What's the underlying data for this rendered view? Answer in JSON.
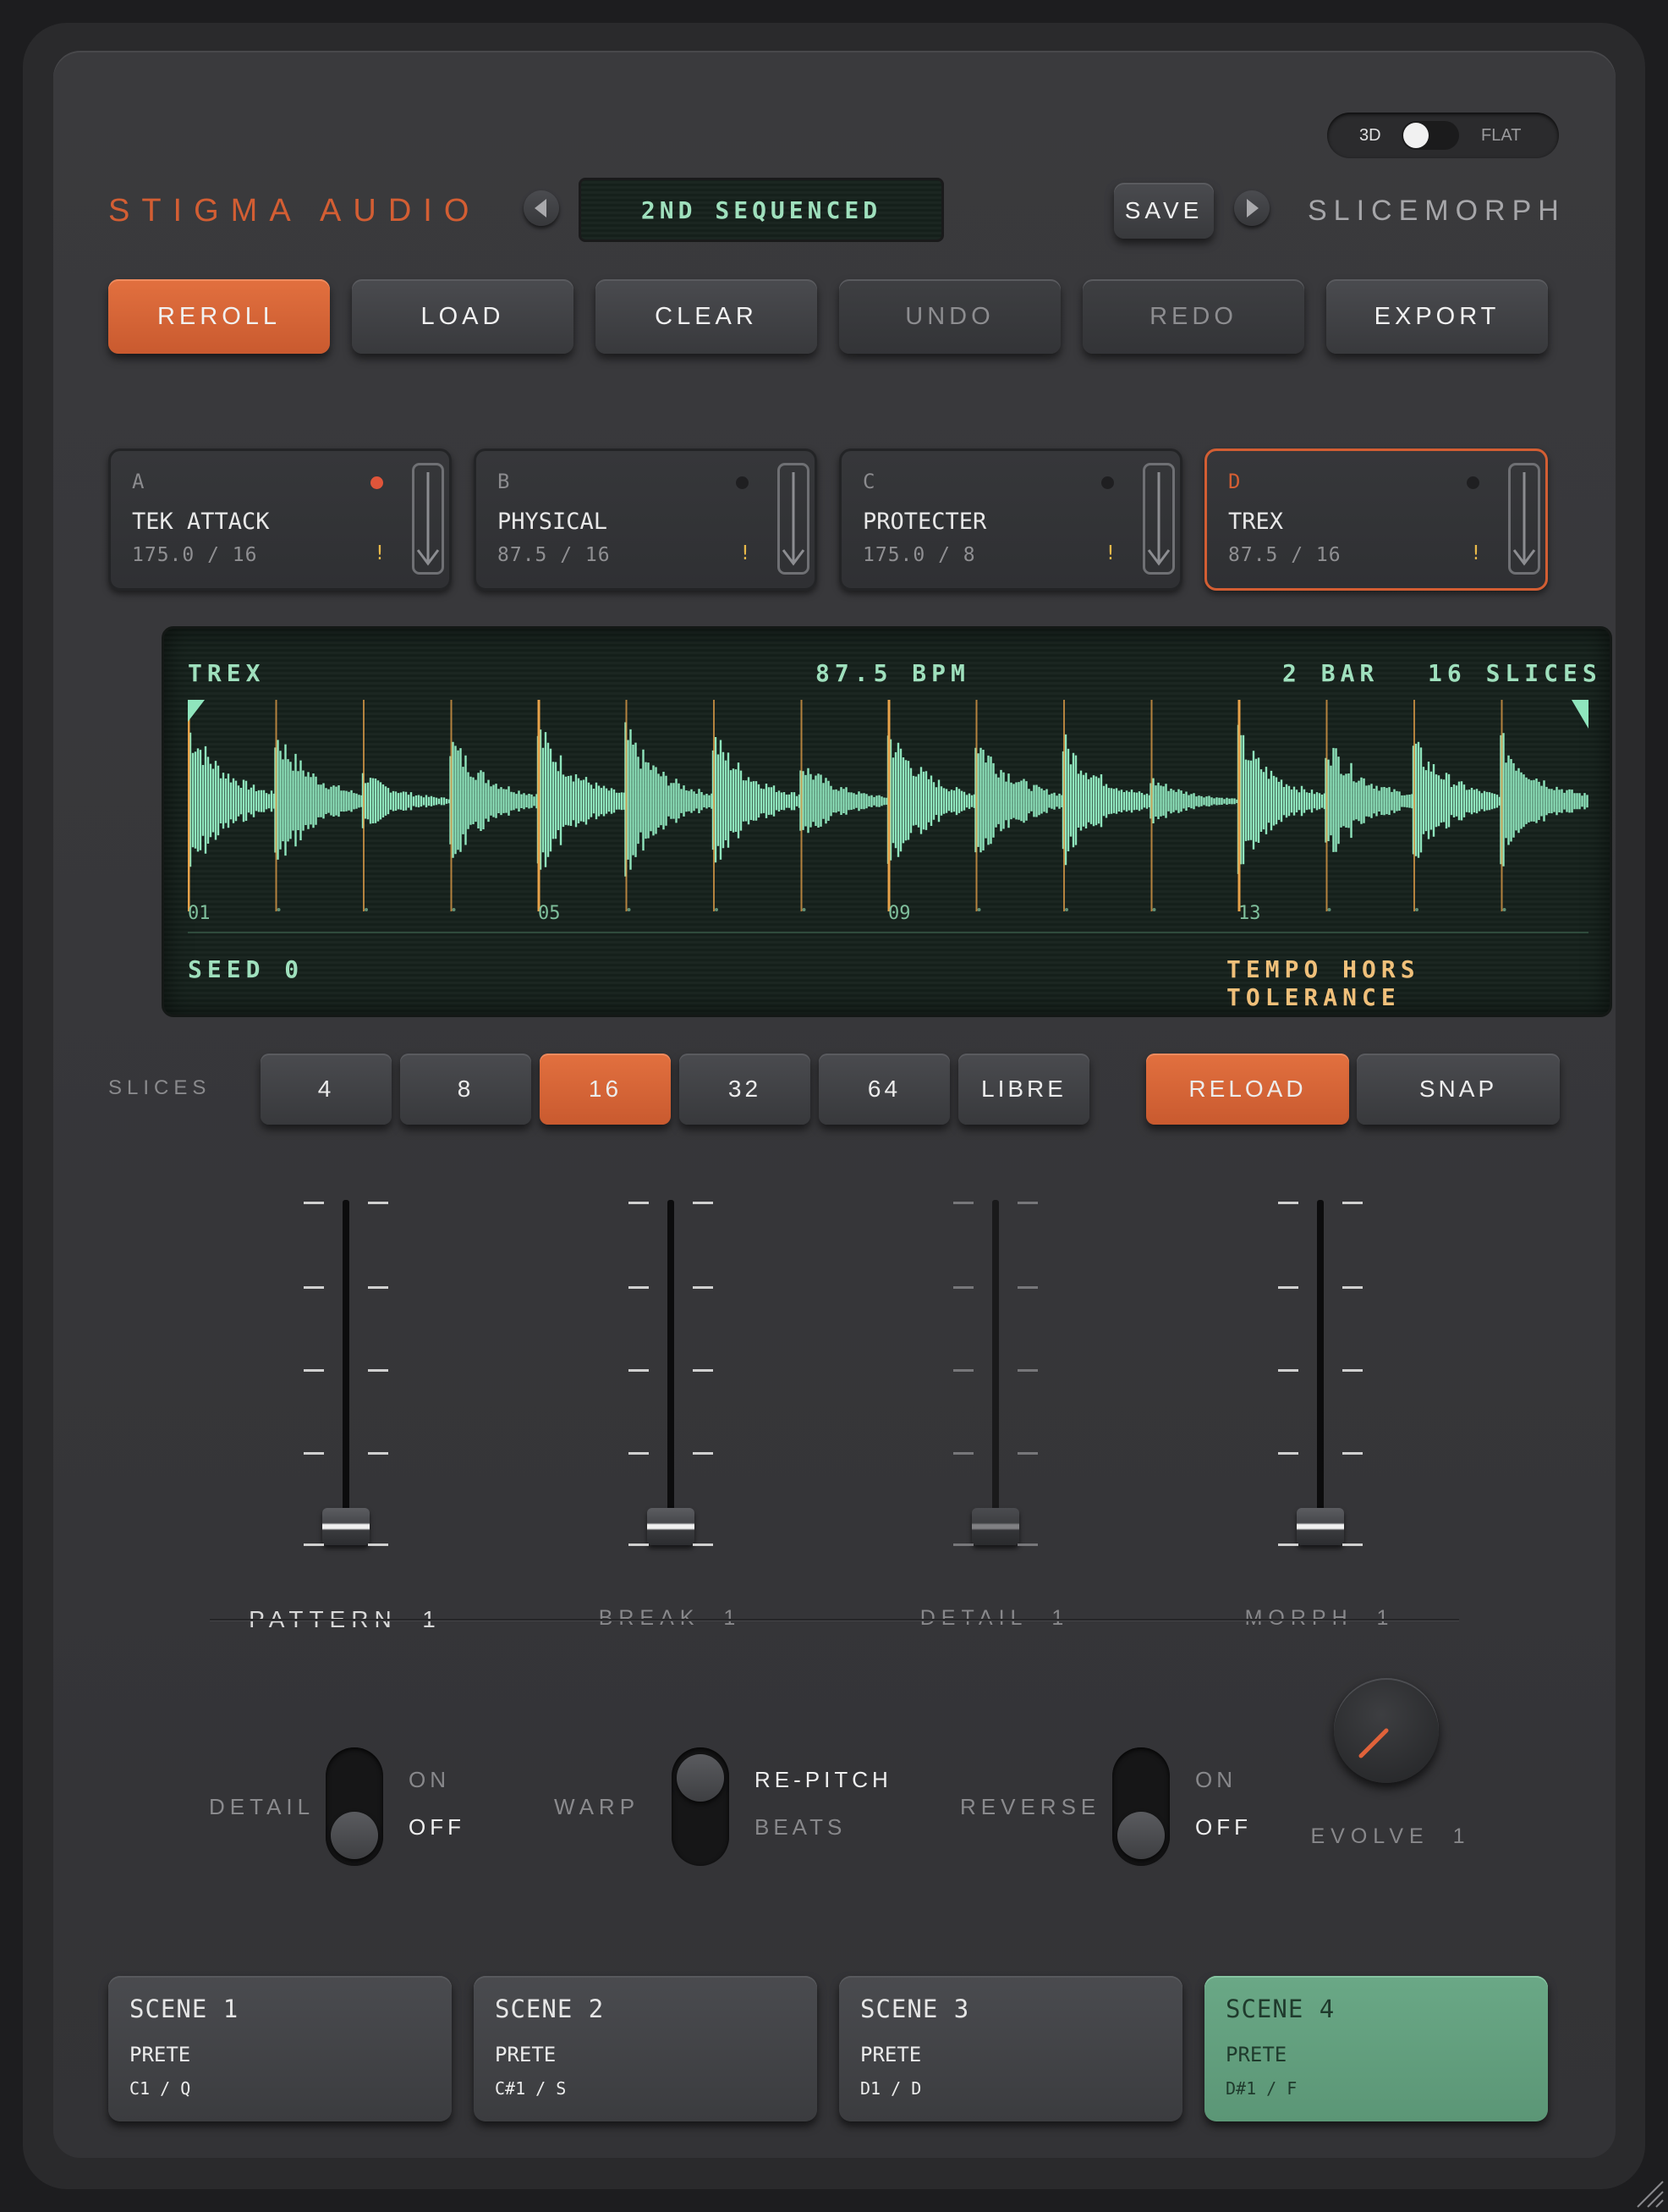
{
  "header": {
    "brand": "STIGMA AUDIO",
    "preset_name": "2ND SEQUENCED",
    "save_label": "SAVE",
    "product": "SLICEMORPH",
    "mode_left": "3D",
    "mode_right": "FLAT"
  },
  "toolbar": [
    {
      "label": "REROLL",
      "style": "orange"
    },
    {
      "label": "LOAD",
      "style": "normal"
    },
    {
      "label": "CLEAR",
      "style": "normal"
    },
    {
      "label": "UNDO",
      "style": "dim"
    },
    {
      "label": "REDO",
      "style": "dim"
    },
    {
      "label": "EXPORT",
      "style": "normal"
    }
  ],
  "slots": [
    {
      "letter": "A",
      "name": "TEK ATTACK",
      "info": "175.0 / 16",
      "warn": "!",
      "active_dot": true,
      "selected": false
    },
    {
      "letter": "B",
      "name": "PHYSICAL",
      "info": "87.5 / 16",
      "warn": "!",
      "active_dot": false,
      "selected": false
    },
    {
      "letter": "C",
      "name": "PROTECTER",
      "info": "175.0 / 8",
      "warn": "!",
      "active_dot": false,
      "selected": false
    },
    {
      "letter": "D",
      "name": "TREX",
      "info": "87.5 / 16",
      "warn": "!",
      "active_dot": false,
      "selected": true
    }
  ],
  "waveform": {
    "name": "TREX",
    "bpm": "87.5 BPM",
    "bars": "2 BAR",
    "slices": "16 SLICES",
    "markers": [
      "01",
      "05",
      "09",
      "13"
    ],
    "seed": "SEED 0",
    "warning": "TEMPO HORS TOLERANCE",
    "wave_color": "#8fe5bd",
    "marker_color": "#e8a24a"
  },
  "slices_row": {
    "label": "SLICES",
    "options": [
      "4",
      "8",
      "16",
      "32",
      "64",
      "LIBRE"
    ],
    "selected": "16",
    "reload": "RELOAD",
    "snap": "SNAP"
  },
  "faders": [
    {
      "label": "PATTERN",
      "value": "1",
      "dim": false
    },
    {
      "label": "BREAK",
      "value": "1",
      "dim": false
    },
    {
      "label": "DETAIL",
      "value": "1",
      "dim": true
    },
    {
      "label": "MORPH",
      "value": "1",
      "dim": false
    }
  ],
  "switches": [
    {
      "label": "DETAIL",
      "top": "ON",
      "bottom": "OFF",
      "state": "bottom"
    },
    {
      "label": "WARP",
      "top": "RE-PITCH",
      "bottom": "BEATS",
      "state": "top"
    },
    {
      "label": "REVERSE",
      "top": "ON",
      "bottom": "OFF",
      "state": "bottom"
    }
  ],
  "evolve": {
    "label": "EVOLVE",
    "value": "1"
  },
  "scenes": [
    {
      "title": "SCENE 1",
      "state": "PRETE",
      "keys": "C1 / Q",
      "active": false
    },
    {
      "title": "SCENE 2",
      "state": "PRETE",
      "keys": "C#1 / S",
      "active": false
    },
    {
      "title": "SCENE 3",
      "state": "PRETE",
      "keys": "D1 / D",
      "active": false
    },
    {
      "title": "SCENE 4",
      "state": "PRETE",
      "keys": "D#1 / F",
      "active": true
    }
  ],
  "colors": {
    "accent": "#d35e33",
    "scene_active": "#63a07f",
    "wave": "#8fe5bd"
  }
}
